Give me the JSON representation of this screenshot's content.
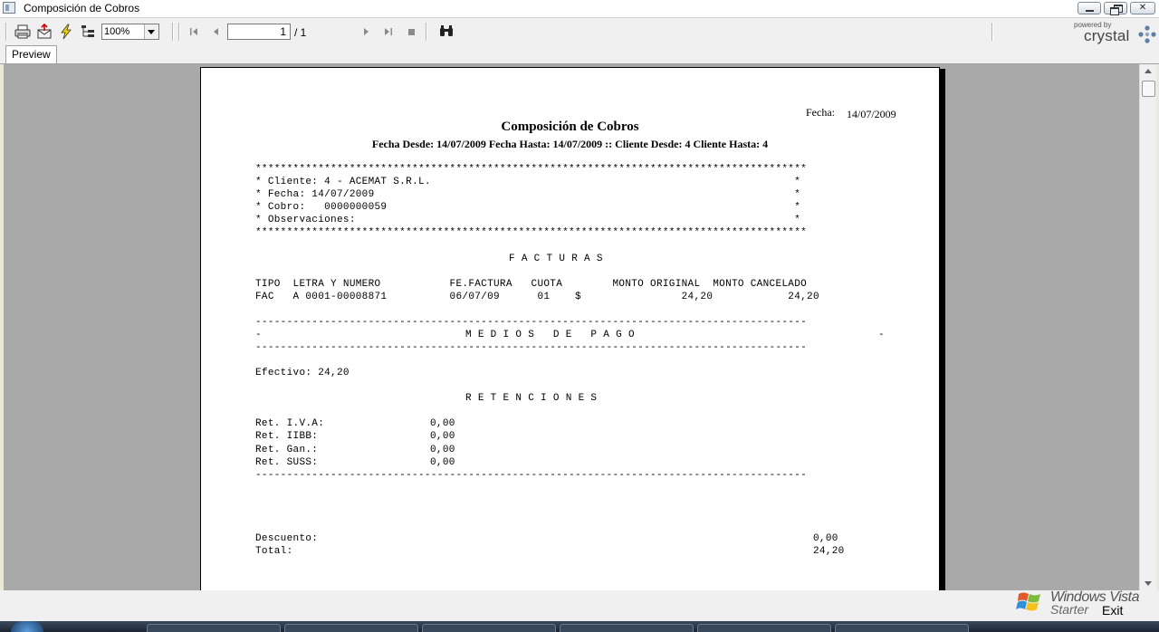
{
  "window": {
    "title": "Composición de Cobros"
  },
  "toolbar": {
    "zoom_value": "100%",
    "page_current": "1",
    "page_total": "/ 1",
    "powered_by": "powered by",
    "brand": "crystal"
  },
  "tabs": [
    {
      "label": "Preview"
    }
  ],
  "report": {
    "fecha_label": "Fecha:",
    "fecha_value": "14/07/2009",
    "title": "Composición de Cobros",
    "subtitle": "Fecha Desde: 14/07/2009 Fecha Hasta: 14/07/2009 :: Cliente Desde: 4 Cliente Hasta: 4",
    "box_border": "****************************************************************************************",
    "box_lines": [
      "* Cliente: 4 - ACEMAT S.R.L.                                                          *",
      "* Fecha: 14/07/2009                                                                   *",
      "* Cobro:   0000000059                                                                 *",
      "* Observaciones:                                                                      *"
    ],
    "facturas_heading": "F A C T U R A S",
    "facturas_header": "TIPO  LETRA Y NUMERO           FE.FACTURA   CUOTA        MONTO ORIGINAL  MONTO CANCELADO",
    "facturas_rows": [
      "FAC   A 0001-00008871          06/07/09      01    $                24,20            24,20"
    ],
    "dash_line": "----------------------------------------------------------------------------------------",
    "medios_left": "-",
    "medios_heading": "M E D I O S   D E   P A G O",
    "medios_right": "-",
    "efectivo": "Efectivo: 24,20",
    "retenciones_heading": "R E T E N C I O N E S",
    "retenciones": [
      {
        "label": "Ret. I.V.A:",
        "value": "0,00"
      },
      {
        "label": "Ret. IIBB:",
        "value": "0,00"
      },
      {
        "label": "Ret. Gan.:",
        "value": "0,00"
      },
      {
        "label": "Ret. SUSS:",
        "value": "0,00"
      }
    ],
    "descuento_label": "Descuento:",
    "descuento_value": "0,00",
    "total_label": "Total:",
    "total_value": "24,20"
  },
  "statusbar": {
    "os_line1": "Windows Vista",
    "os_line2": "Starter",
    "exit_label": "Exit"
  }
}
